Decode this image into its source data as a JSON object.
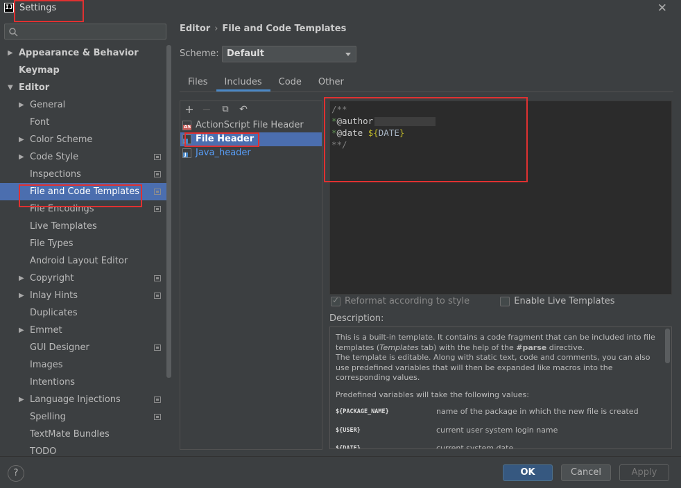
{
  "window": {
    "app_icon_text": "IJ",
    "title": "Settings",
    "close_glyph": "✕"
  },
  "search": {
    "placeholder": ""
  },
  "sidebar": {
    "items": [
      {
        "label": "Appearance & Behavior",
        "level": 0,
        "arrow": "▶",
        "bold": true
      },
      {
        "label": "Keymap",
        "level": 0,
        "arrow": "",
        "bold": true
      },
      {
        "label": "Editor",
        "level": 0,
        "arrow": "▼",
        "bold": true
      },
      {
        "label": "General",
        "level": 1,
        "arrow": "▶"
      },
      {
        "label": "Font",
        "level": 1,
        "arrow": ""
      },
      {
        "label": "Color Scheme",
        "level": 1,
        "arrow": "▶"
      },
      {
        "label": "Code Style",
        "level": 1,
        "arrow": "▶",
        "project_icon": true
      },
      {
        "label": "Inspections",
        "level": 1,
        "arrow": "",
        "project_icon": true
      },
      {
        "label": "File and Code Templates",
        "level": 1,
        "arrow": "",
        "project_icon": true,
        "selected": true
      },
      {
        "label": "File Encodings",
        "level": 1,
        "arrow": "",
        "project_icon": true
      },
      {
        "label": "Live Templates",
        "level": 1,
        "arrow": ""
      },
      {
        "label": "File Types",
        "level": 1,
        "arrow": ""
      },
      {
        "label": "Android Layout Editor",
        "level": 1,
        "arrow": ""
      },
      {
        "label": "Copyright",
        "level": 1,
        "arrow": "▶",
        "project_icon": true
      },
      {
        "label": "Inlay Hints",
        "level": 1,
        "arrow": "▶",
        "project_icon": true
      },
      {
        "label": "Duplicates",
        "level": 1,
        "arrow": ""
      },
      {
        "label": "Emmet",
        "level": 1,
        "arrow": "▶"
      },
      {
        "label": "GUI Designer",
        "level": 1,
        "arrow": "",
        "project_icon": true
      },
      {
        "label": "Images",
        "level": 1,
        "arrow": ""
      },
      {
        "label": "Intentions",
        "level": 1,
        "arrow": ""
      },
      {
        "label": "Language Injections",
        "level": 1,
        "arrow": "▶",
        "project_icon": true
      },
      {
        "label": "Spelling",
        "level": 1,
        "arrow": "",
        "project_icon": true
      },
      {
        "label": "TextMate Bundles",
        "level": 1,
        "arrow": ""
      },
      {
        "label": "TODO",
        "level": 1,
        "arrow": ""
      }
    ]
  },
  "breadcrumb": {
    "section": "Editor",
    "separator": "›",
    "page": "File and Code Templates"
  },
  "scheme": {
    "label": "Scheme:",
    "value": "Default"
  },
  "tabs": [
    {
      "label": "Files",
      "active": false
    },
    {
      "label": "Includes",
      "active": true
    },
    {
      "label": "Code",
      "active": false
    },
    {
      "label": "Other",
      "active": false
    }
  ],
  "toolbar": {
    "add": "+",
    "remove": "−",
    "copy": "⧉",
    "reset": "↶"
  },
  "templates": [
    {
      "label": "ActionScript File Header",
      "icon": "as",
      "selected": false,
      "link": false
    },
    {
      "label": "File Header",
      "icon": "java",
      "selected": true,
      "link": false
    },
    {
      "label": "Java_header",
      "icon": "java",
      "selected": false,
      "link": true
    }
  ],
  "editor": {
    "line1": "/**",
    "star": "*",
    "author_tag": "@author",
    "date_tag": "@date ",
    "date_var_open": "${",
    "date_var": "DATE",
    "date_var_close": "}",
    "line4": "**/"
  },
  "options": {
    "reformat": {
      "label": "Reformat according to style",
      "checked": true,
      "enabled": false
    },
    "live_templates": {
      "label": "Enable Live Templates",
      "checked": false,
      "enabled": true
    }
  },
  "description": {
    "label": "Description:",
    "p1_a": "This is a built-in template. It contains a code fragment that can be included into file templates (",
    "p1_em": "Templates",
    "p1_b": " tab) with the help of the ",
    "p1_strong": "#parse",
    "p1_c": " directive.",
    "p1_d": "The template is editable. Along with static text, code and comments, you can also use predefined variables that will then be expanded like macros into the corresponding values.",
    "p2": "Predefined variables will take the following values:",
    "vars": [
      {
        "name": "${PACKAGE_NAME}",
        "desc": "name of the package in which the new file is created"
      },
      {
        "name": "${USER}",
        "desc": "current user system login name"
      },
      {
        "name": "${DATE}",
        "desc": "current system date"
      }
    ]
  },
  "footer": {
    "help": "?",
    "ok": "OK",
    "cancel": "Cancel",
    "apply": "Apply"
  },
  "colors": {
    "selection": "#4b6eaf",
    "ok_button": "#365880",
    "annotation": "#e03131"
  }
}
